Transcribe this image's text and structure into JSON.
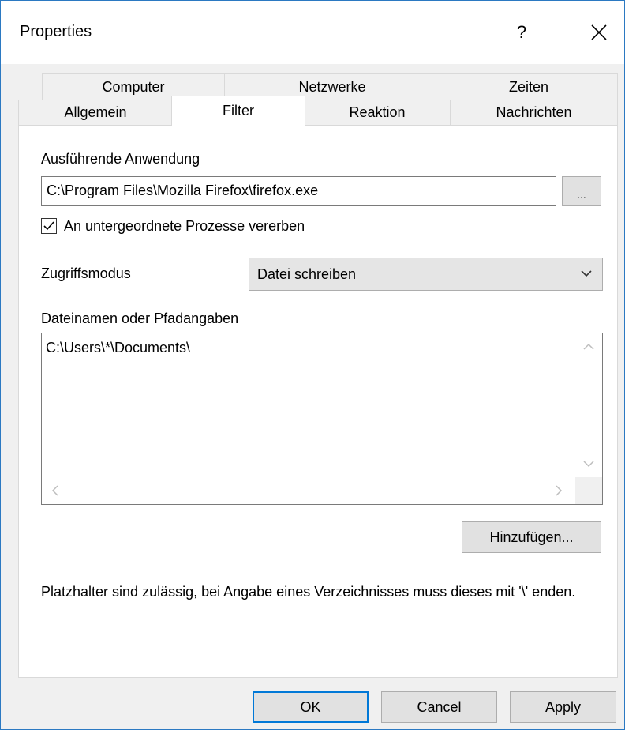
{
  "window": {
    "title": "Properties",
    "help_label": "?"
  },
  "tabs": {
    "row1": [
      "Computer",
      "Netzwerke",
      "Zeiten"
    ],
    "row2": [
      "Allgemein",
      "Filter",
      "Reaktion",
      "Nachrichten"
    ],
    "active": "Filter"
  },
  "filter": {
    "app_label": "Ausführende Anwendung",
    "app_value": "C:\\Program Files\\Mozilla Firefox\\firefox.exe",
    "browse_label": "...",
    "inherit_label": "An untergeordnete Prozesse vererben",
    "inherit_checked": true,
    "access_label": "Zugriffsmodus",
    "access_value": "Datei schreiben",
    "paths_label": "Dateinamen oder Pfadangaben",
    "paths_value": "C:\\Users\\*\\Documents\\",
    "add_label": "Hinzufügen...",
    "hint": "Platzhalter sind zulässig, bei Angabe eines Verzeichnisses muss dieses mit '\\' enden."
  },
  "footer": {
    "ok": "OK",
    "cancel": "Cancel",
    "apply": "Apply"
  },
  "colors": {
    "accent": "#0078d7",
    "window_border": "#2b79c2",
    "dialog_bg": "#f0f0f0"
  },
  "icons": {
    "help": "question-mark",
    "close": "close-icon",
    "check": "check-icon",
    "dropdown": "chevron-down-icon"
  }
}
